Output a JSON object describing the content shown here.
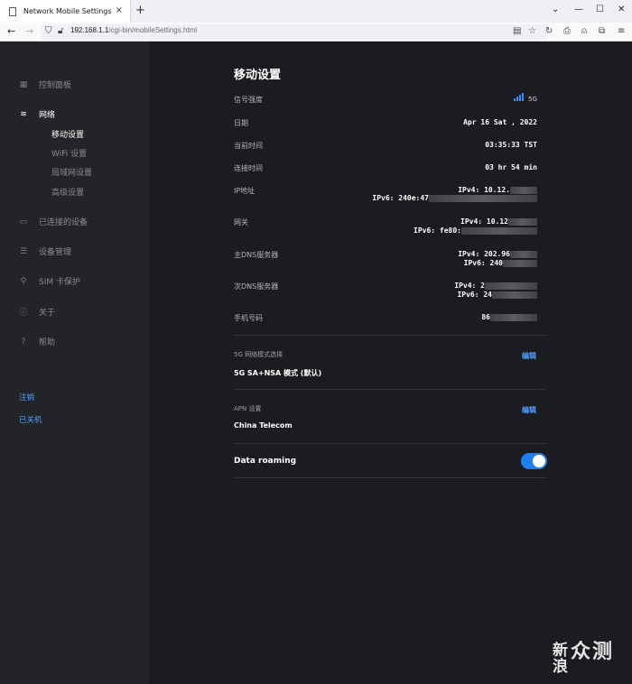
{
  "browser": {
    "tab_title": "Network Mobile Settings",
    "tab_close": "×",
    "new_tab": "+",
    "window_controls": [
      "⌄",
      "—",
      "☐",
      "✕"
    ],
    "back": "←",
    "forward": "→",
    "url_host": "192.168.1.1",
    "url_path": "/cgi-bin/mobileSettings.html"
  },
  "sidebar": {
    "items": [
      {
        "label": "控制面板",
        "icon": "dashboard-icon"
      },
      {
        "label": "网络",
        "icon": "wifi-icon"
      },
      {
        "label": "已连接的设备",
        "icon": "devices-icon"
      },
      {
        "label": "设备管理",
        "icon": "sliders-icon"
      },
      {
        "label": "SIM 卡保护",
        "icon": "lock-icon"
      },
      {
        "label": "关于",
        "icon": "info-icon"
      },
      {
        "label": "帮助",
        "icon": "help-icon"
      }
    ],
    "sub_items": [
      "移动设置",
      "WiFi 设置",
      "局域网设置",
      "高级设置"
    ],
    "logout": "注销",
    "shutdown": "已关机"
  },
  "main": {
    "title": "移动设置",
    "signal_label": "信号强度",
    "signal_type": "5G",
    "signal_level": 4,
    "date_label": "日期",
    "date_value": "Apr 16 Sat , 2022",
    "time_label": "当前时间",
    "time_value": "03:35:33 TST",
    "uptime_label": "连接时间",
    "uptime_value": "03 hr 54 min",
    "ip_label": "IP地址",
    "ip_v4": "IPv4: 10.12.",
    "ip_v6": "IPv6: 240e:47",
    "gateway_label": "网关",
    "gateway_v4": "IPv4: 10.12",
    "gateway_v6": "IPv6: fe80:",
    "dns1_label": "主DNS服务器",
    "dns1_v4": "IPv4: 202.96",
    "dns1_v6": "IPv6: 240",
    "dns2_label": "次DNS服务器",
    "dns2_v4": "IPv4: 2",
    "dns2_v6": "IPv6: 24",
    "phone_label": "手机号码",
    "phone_value": "86",
    "mode_label": "5G 网络模式选择",
    "mode_edit": "编辑",
    "mode_value": "5G SA+NSA 模式 (默认)",
    "apn_label": "APN 设置",
    "apn_edit": "编辑",
    "apn_value": "China Telecom",
    "roaming_label": "Data roaming",
    "roaming_on": true
  },
  "watermark": {
    "line1": "新",
    "line2": "浪",
    "text": "众测"
  }
}
